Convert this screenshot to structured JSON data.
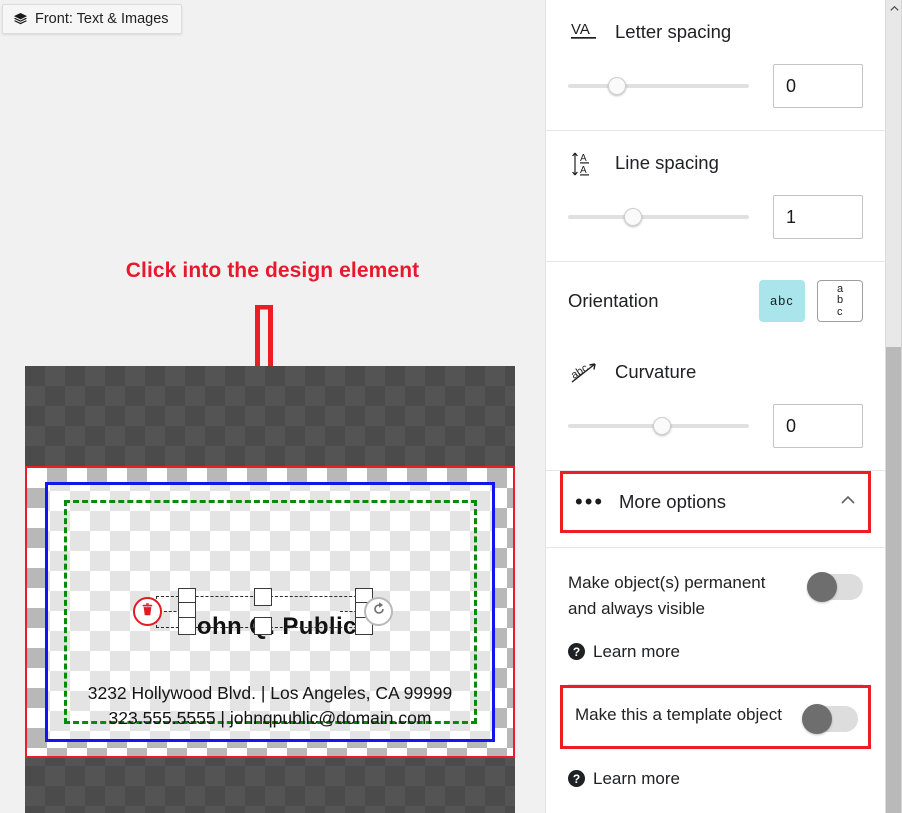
{
  "canvas": {
    "layer_chip": {
      "label": "Front: Text & Images",
      "icon": "layers-icon"
    },
    "annotation": "Click into the design element",
    "design": {
      "name_text": "John Q. Public",
      "address_line": "3232 Hollywood Blvd.  |  Los Angeles, CA 99999",
      "contact_line": "323.555.5555  |  johnqpublic@domain.com"
    },
    "selection": {
      "delete_icon": "trash-icon",
      "rotate_icon": "rotate-icon"
    },
    "colors": {
      "annotation_red": "#e8192c",
      "selection_red": "#ee1c25",
      "bleed_blue": "#1414ee",
      "safe_green": "#0a8a0a"
    }
  },
  "panel": {
    "letter_spacing": {
      "icon": "letter-spacing-icon",
      "label": "Letter spacing",
      "value": "0",
      "slider_percent": 25
    },
    "line_spacing": {
      "icon": "line-spacing-icon",
      "label": "Line spacing",
      "value": "1",
      "slider_percent": 34
    },
    "orientation": {
      "label": "Orientation",
      "horizontal_label": "abc",
      "vertical_letters": [
        "a",
        "b",
        "c"
      ],
      "selected": "horizontal",
      "selected_color": "#a9e5eb"
    },
    "curvature": {
      "icon": "curvature-icon",
      "label": "Curvature",
      "value": "0",
      "slider_percent": 50
    },
    "more_options": {
      "icon": "more-dots-icon",
      "label": "More options",
      "chevron": "chevron-up-icon",
      "expanded": true,
      "highlight_color": "#ee1c25"
    },
    "permanent_option": {
      "label": "Make object(s) permanent and always visible",
      "toggle_on": false,
      "learn_more": "Learn more"
    },
    "template_option": {
      "label": "Make this a template object",
      "toggle_on": false,
      "learn_more": "Learn more",
      "highlight_color": "#ee1c25"
    }
  },
  "scrollbar": {
    "up_arrow_icon": "chevron-up-icon",
    "thumb_name": "vertical-scroll-thumb"
  }
}
